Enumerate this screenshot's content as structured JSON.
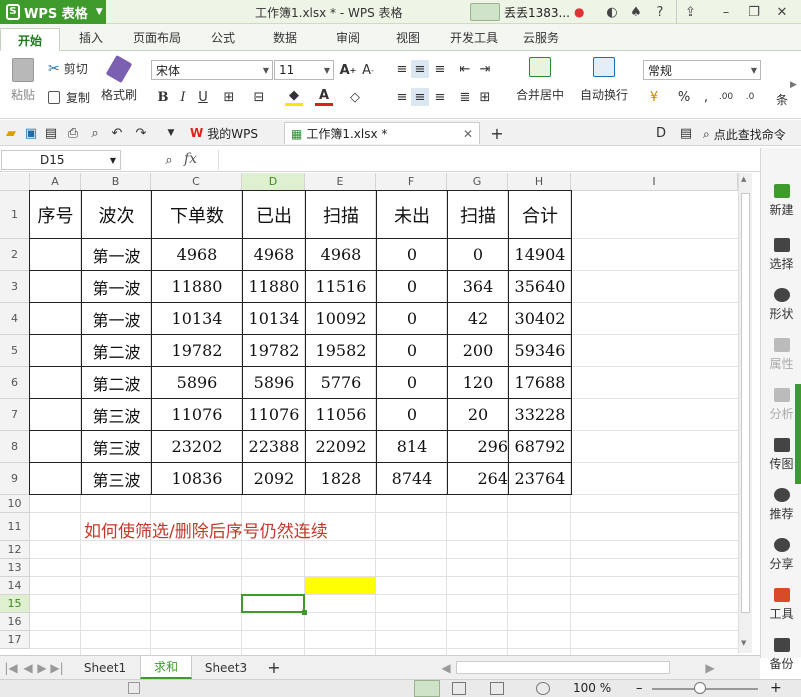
{
  "titlebar": {
    "app_button": "WPS 表格",
    "title": "工作簿1.xlsx * - WPS 表格",
    "user": "丢丢1383...",
    "minimize": "–",
    "restore": "❐",
    "close": "✕"
  },
  "ribbon_tabs": [
    "开始",
    "插入",
    "页面布局",
    "公式",
    "数据",
    "审阅",
    "视图",
    "开发工具",
    "云服务"
  ],
  "ribbon": {
    "paste": "粘贴",
    "cut": "剪切",
    "copy": "复制",
    "format_painter": "格式刷",
    "font_name": "宋体",
    "font_size": "11",
    "merge_center": "合并居中",
    "wrap_text": "自动换行",
    "number_format": "常规",
    "cond": "条"
  },
  "doc_tabs": {
    "mywps": "我的WPS",
    "workbook": "工作簿1.xlsx *",
    "search": "点此查找命令"
  },
  "formula_bar": {
    "name_box": "D15",
    "fx": "fx",
    "value": ""
  },
  "columns": [
    "A",
    "B",
    "C",
    "D",
    "E",
    "F",
    "G",
    "H",
    "I"
  ],
  "rows": [
    "1",
    "2",
    "3",
    "4",
    "5",
    "6",
    "7",
    "8",
    "9",
    "10",
    "11",
    "12",
    "13",
    "14",
    "15",
    "16",
    "17"
  ],
  "sheet": {
    "header": [
      "序号",
      "波次",
      "下单数",
      "已出",
      "扫描",
      "未出",
      "扫描",
      "合计"
    ],
    "data": [
      [
        "",
        "第一波",
        "4968",
        "4968",
        "4968",
        "0",
        "0",
        "14904"
      ],
      [
        "",
        "第一波",
        "11880",
        "11880",
        "11516",
        "0",
        "364",
        "35640"
      ],
      [
        "",
        "第一波",
        "10134",
        "10134",
        "10092",
        "0",
        "42",
        "30402"
      ],
      [
        "",
        "第二波",
        "19782",
        "19782",
        "19582",
        "0",
        "200",
        "59346"
      ],
      [
        "",
        "第二波",
        "5896",
        "5896",
        "5776",
        "0",
        "120",
        "17688"
      ],
      [
        "",
        "第三波",
        "11076",
        "11076",
        "11056",
        "0",
        "20",
        "33228"
      ],
      [
        "",
        "第三波",
        "23202",
        "22388",
        "22092",
        "814",
        "296",
        "68792"
      ],
      [
        "",
        "第三波",
        "10836",
        "2092",
        "1828",
        "8744",
        "264",
        "23764"
      ]
    ],
    "note": "如何使筛选/删除后序号仍然连续",
    "highlight_color": "#ffff00",
    "note_color": "#c0392b",
    "selected_cell": "D15",
    "accent_color": "#3e9a2b"
  },
  "sidebar": [
    "新建",
    "选择",
    "形状",
    "属性",
    "分析",
    "传图",
    "推荐",
    "分享",
    "工具",
    "备份"
  ],
  "sheet_tabs": [
    "Sheet1",
    "求和",
    "Sheet3"
  ],
  "active_sheet": "求和",
  "status": {
    "zoom": "100 %"
  }
}
